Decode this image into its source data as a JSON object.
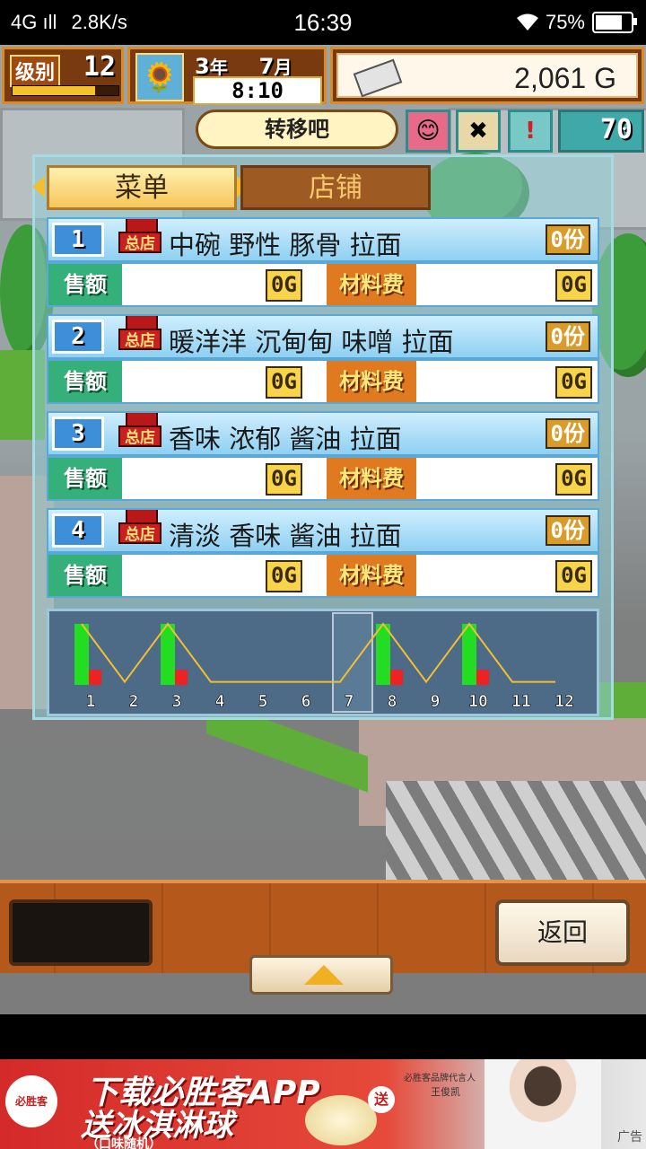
{
  "status_bar": {
    "network": "4G",
    "speed": "2.8K/s",
    "time": "16:39",
    "battery": "75%",
    "battery_level": 0.75
  },
  "hud": {
    "level_label": "级别",
    "level": "12",
    "level_progress": 0.78,
    "year_num": "3",
    "year_unit": "年",
    "month_num": "7",
    "month_unit": "月",
    "clock": "8:10",
    "money": "2,061 G",
    "action_label": "转移吧",
    "counter": "70"
  },
  "tabs": {
    "menu": "菜单",
    "shop": "店铺"
  },
  "rows": [
    {
      "index": "1",
      "store_sign": "总店",
      "name": "中碗 野性 豚骨 拉面",
      "count": "0份",
      "sales_label": "售额",
      "sales": "0G",
      "material_label": "材料费",
      "material": "0G"
    },
    {
      "index": "2",
      "store_sign": "总店",
      "name": "暖洋洋 沉甸甸 味噌 拉面",
      "count": "0份",
      "sales_label": "售额",
      "sales": "0G",
      "material_label": "材料费",
      "material": "0G"
    },
    {
      "index": "3",
      "store_sign": "总店",
      "name": "香味 浓郁 酱油 拉面",
      "count": "0份",
      "sales_label": "售额",
      "sales": "0G",
      "material_label": "材料费",
      "material": "0G"
    },
    {
      "index": "4",
      "store_sign": "总店",
      "name": "清淡 香味 酱油 拉面",
      "count": "0份",
      "sales_label": "售额",
      "sales": "0G",
      "material_label": "材料费",
      "material": "0G"
    }
  ],
  "chart_data": {
    "type": "bar",
    "categories": [
      "1",
      "2",
      "3",
      "4",
      "5",
      "6",
      "7",
      "8",
      "9",
      "10",
      "11",
      "12"
    ],
    "series": [
      {
        "values": [
          1.0,
          0,
          1.0,
          0,
          0,
          0,
          0,
          1.0,
          0,
          1.0,
          0,
          0
        ],
        "color": "#22dd22"
      },
      {
        "values": [
          0.25,
          0,
          0.25,
          0,
          0,
          0,
          0,
          0.25,
          0,
          0.25,
          0,
          0
        ],
        "color": "#ee2222"
      }
    ],
    "line": [
      1.0,
      0.05,
      1.0,
      0.05,
      0.05,
      0.05,
      0.05,
      1.0,
      0.05,
      1.0,
      0.05,
      0.05
    ],
    "line_color": "#f0c030",
    "selected_month": "7"
  },
  "bottom": {
    "back_label": "返回"
  },
  "ad": {
    "logo": "必胜客",
    "line1": "下载必胜客APP",
    "line2": "送冰淇淋球",
    "line3": "（口味随机）",
    "badge": "送",
    "small1": "必胜客品牌代言人",
    "small2": "王俊凯",
    "tag": "广告"
  }
}
